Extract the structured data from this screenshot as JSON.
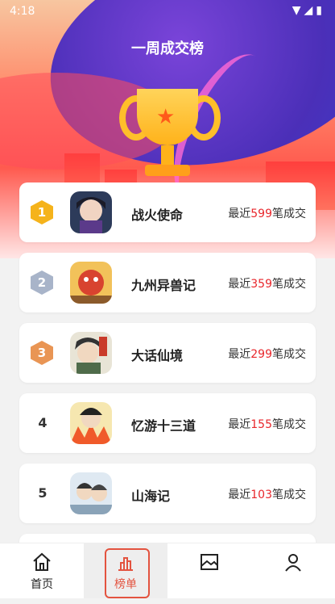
{
  "status_bar": {
    "time": "4:18",
    "icons": "▼◢▮"
  },
  "header": {
    "title": "一周成交榜"
  },
  "ranking": [
    {
      "rank": "1",
      "name": "战火使命",
      "prefix": "最近",
      "count": "599",
      "suffix": "笔成交",
      "badge": "gold"
    },
    {
      "rank": "2",
      "name": "九州异兽记",
      "prefix": "最近",
      "count": "359",
      "suffix": "笔成交",
      "badge": "silver"
    },
    {
      "rank": "3",
      "name": "大话仙境",
      "prefix": "最近",
      "count": "299",
      "suffix": "笔成交",
      "badge": "bronze"
    },
    {
      "rank": "4",
      "name": "忆游十三道",
      "prefix": "最近",
      "count": "155",
      "suffix": "笔成交",
      "badge": ""
    },
    {
      "rank": "5",
      "name": "山海记",
      "prefix": "最近",
      "count": "103",
      "suffix": "笔成交",
      "badge": ""
    }
  ],
  "tabs": [
    {
      "label": "首页",
      "icon": "home-icon"
    },
    {
      "label": "榜单",
      "icon": "chart-icon"
    },
    {
      "label": "",
      "icon": "image-icon"
    },
    {
      "label": "",
      "icon": "user-icon"
    }
  ],
  "colors": {
    "accent": "#e3533f",
    "count": "#e8262b"
  }
}
